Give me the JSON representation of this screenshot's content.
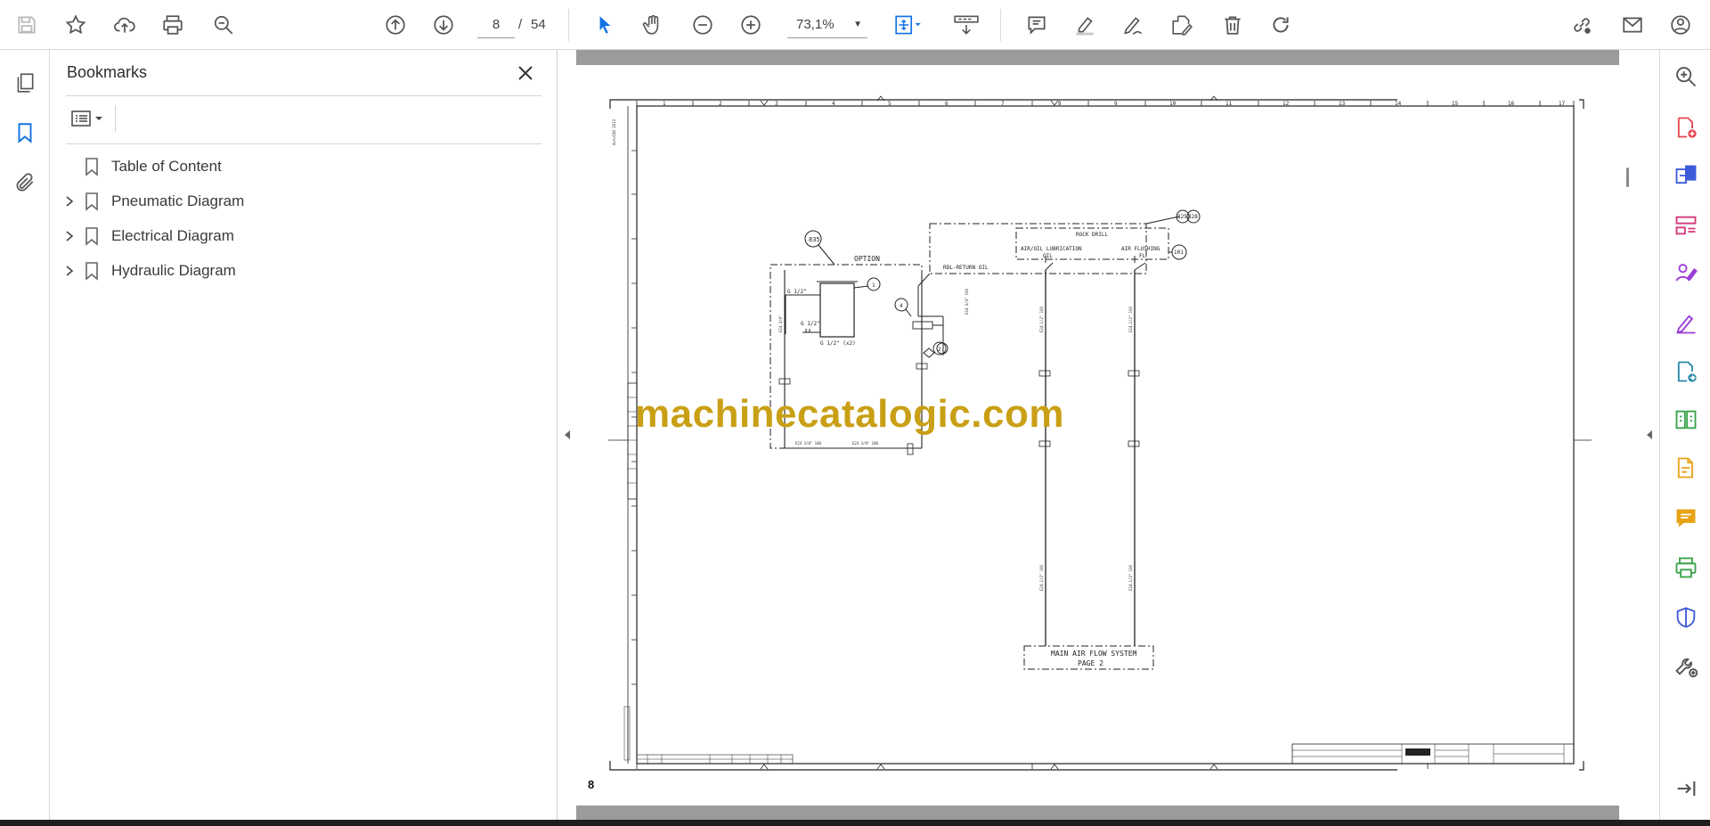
{
  "toolbar": {
    "page_current": "8",
    "page_separator": "/",
    "page_total": "54",
    "zoom": "73,1%"
  },
  "left_rail": {
    "icons": [
      "pages-icon",
      "bookmark-icon",
      "attachment-icon"
    ]
  },
  "bookmarks": {
    "title": "Bookmarks",
    "items": [
      {
        "label": "Table of Content",
        "expandable": false
      },
      {
        "label": "Pneumatic Diagram",
        "expandable": true
      },
      {
        "label": "Electrical Diagram",
        "expandable": true
      },
      {
        "label": "Hydraulic Diagram",
        "expandable": true
      }
    ]
  },
  "document": {
    "page_label": "8",
    "watermark": "machinecatalogic.com",
    "diagram": {
      "option_label": "OPTION",
      "rock_drill_label": "ROCK DRILL",
      "air_oil_label": "AIR/OIL LUBRICATION",
      "air_oil_sub": "OIL",
      "air_flushing_label": "AIR FLUSHING",
      "air_flushing_sub": "FL",
      "return_oil_label": "RDL-RETURN OIL",
      "main_air_label": "MAIN AIR FLOW SYSTEM",
      "main_air_page": "PAGE 2",
      "ref_835": "835",
      "ref_825": "825",
      "ref_828": "828",
      "ref_101": "101",
      "ref_1": "1",
      "ref_2": "2",
      "ref_4": "4",
      "size_half_a": "G 1/2\"",
      "size_half_b": "G 1/2\"",
      "size_half_c": "G 1/2\" (x2)",
      "col_numbers": [
        "1",
        "2",
        "3",
        "4",
        "5",
        "6",
        "7",
        "8",
        "9",
        "10",
        "11",
        "12",
        "13",
        "14",
        "15",
        "16",
        "17"
      ]
    }
  },
  "colors": {
    "accent_blue": "#1473e6",
    "watermark": "#c9a015",
    "toolbar_icon": "#555555"
  }
}
